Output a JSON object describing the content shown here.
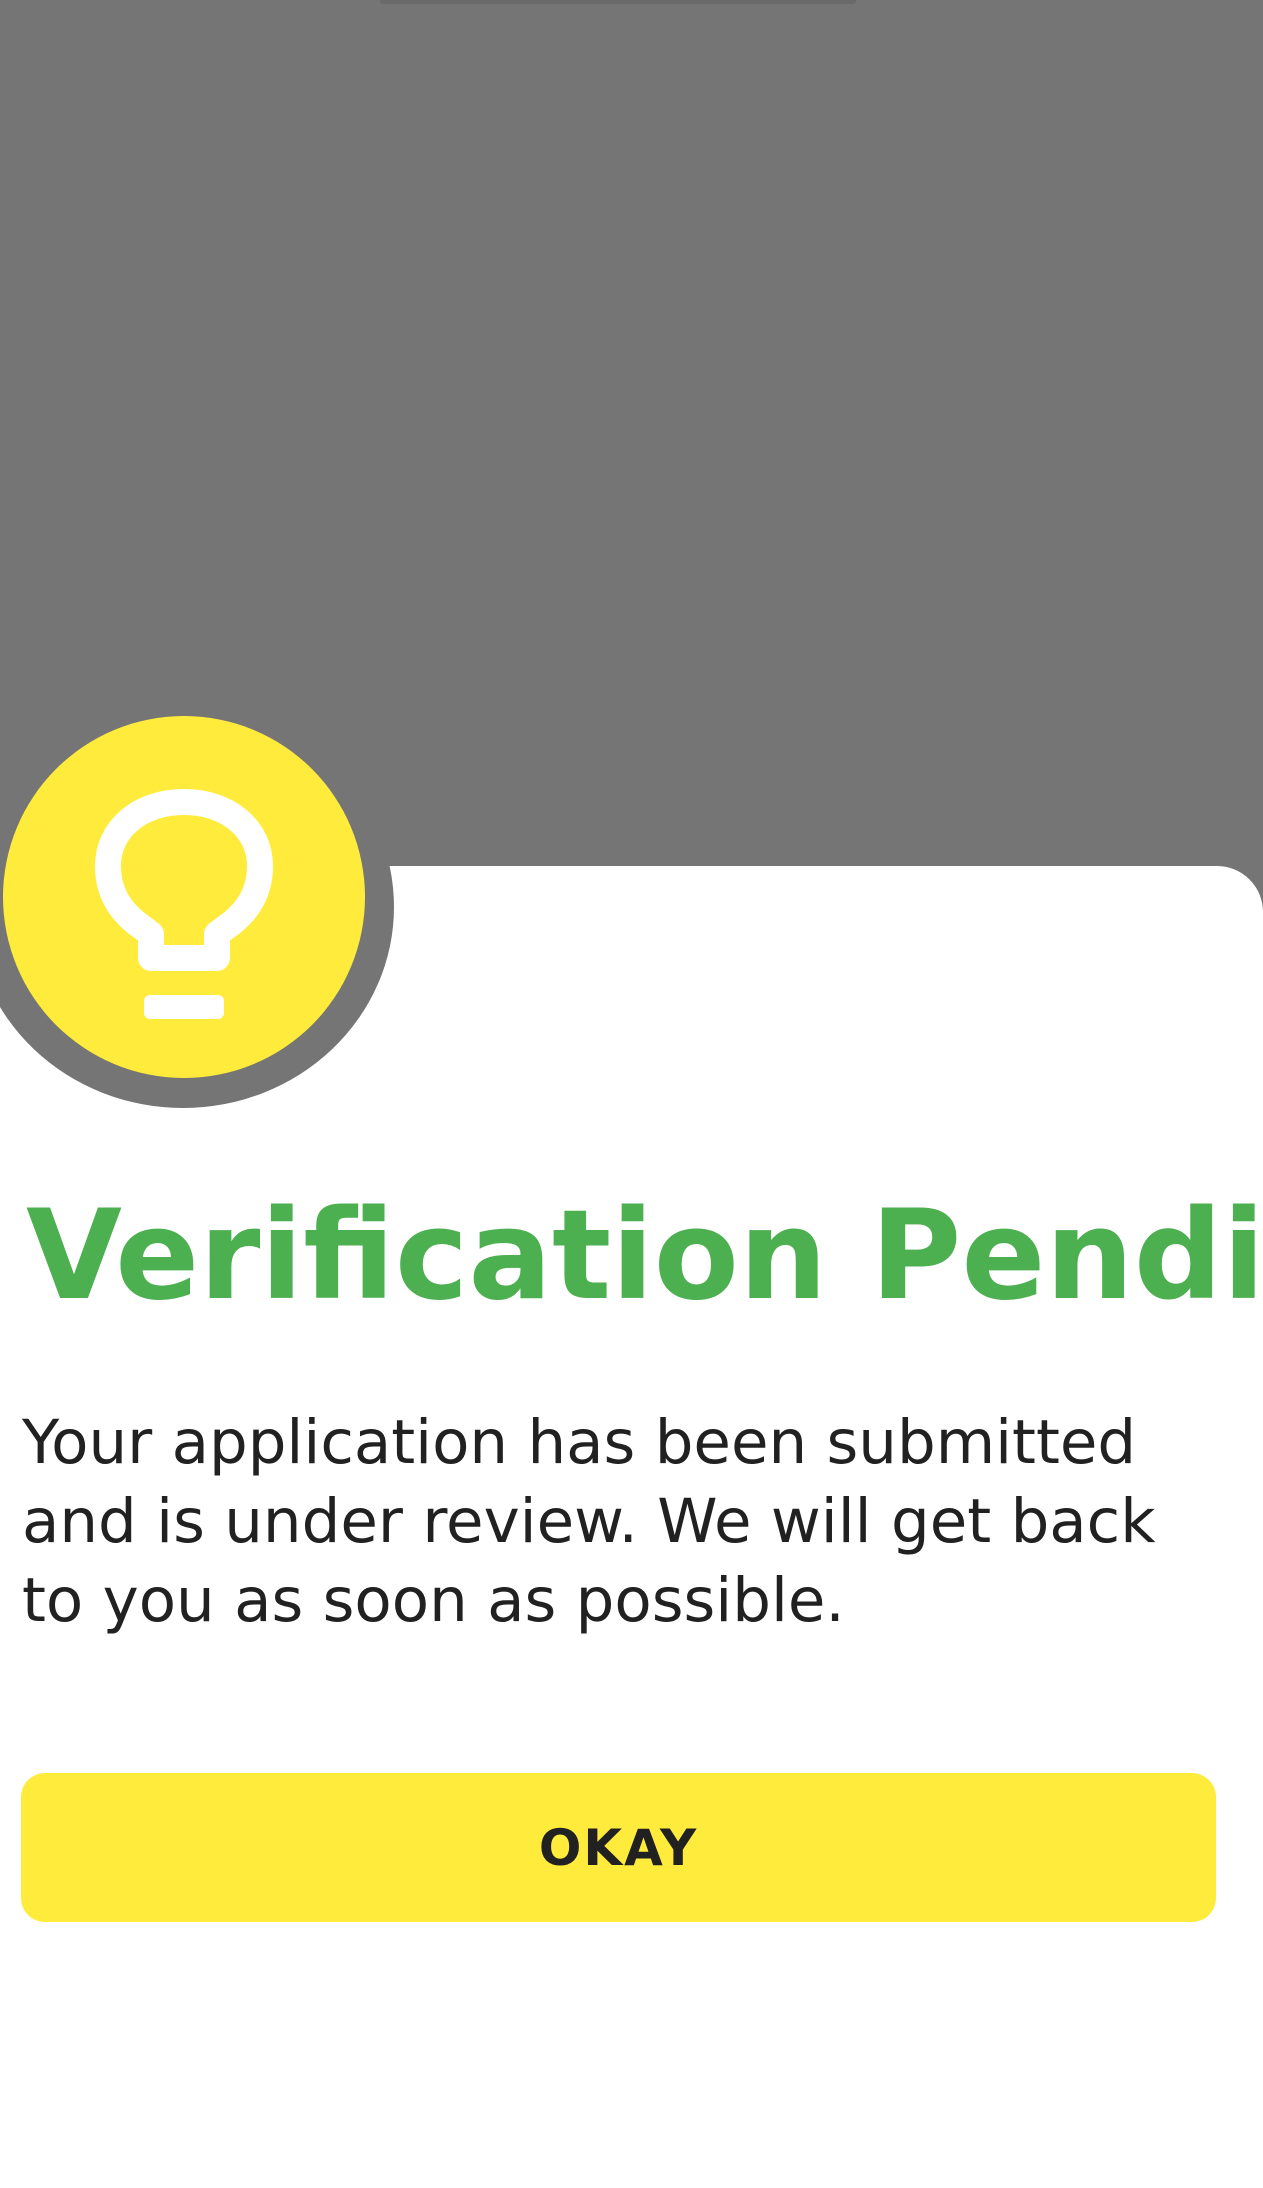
{
  "dialog": {
    "icon": "lightbulb-icon",
    "title": "Verification Pending",
    "message": "Your application has been submitted and is under review. We will get back to you as soon as possible.",
    "okay_label": "OKAY"
  },
  "colors": {
    "backdrop": "#757575",
    "sheet": "#ffffff",
    "accent_yellow": "#ffeb3b",
    "title_green": "#4caf50",
    "text": "#212121",
    "icon": "#ffffff"
  }
}
